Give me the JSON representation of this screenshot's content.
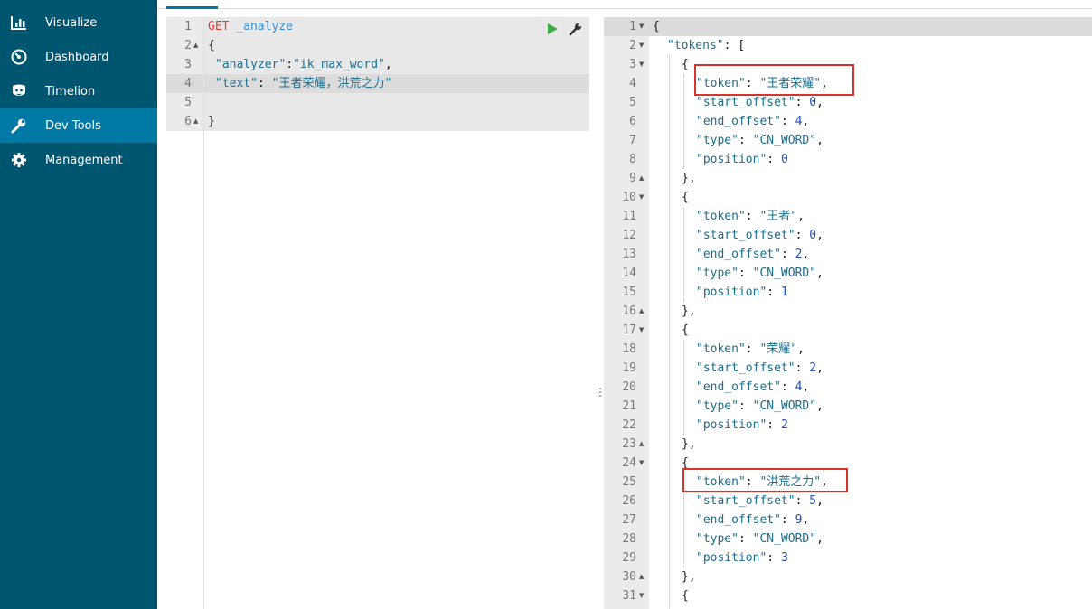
{
  "sidebar": {
    "items": [
      {
        "label": "Visualize",
        "icon": "bar-chart-icon"
      },
      {
        "label": "Dashboard",
        "icon": "dashboard-icon"
      },
      {
        "label": "Timelion",
        "icon": "timelion-icon"
      },
      {
        "label": "Dev Tools",
        "icon": "wrench-icon",
        "active": true
      },
      {
        "label": "Management",
        "icon": "gear-icon"
      }
    ]
  },
  "request": {
    "line_numbers": [
      "1",
      "2",
      "3",
      "4",
      "5",
      "6"
    ],
    "method": "GET",
    "path": "_analyze",
    "open_brace": "{",
    "analyzer_key": "\"analyzer\"",
    "analyzer_value": "\"ik_max_word\"",
    "text_key": "\"text\"",
    "text_value": "\"王者荣耀，洪荒之力\"",
    "close_brace": "}"
  },
  "response": {
    "line_numbers": [
      "1",
      "2",
      "3",
      "4",
      "5",
      "6",
      "7",
      "8",
      "9",
      "10",
      "11",
      "12",
      "13",
      "14",
      "15",
      "16",
      "17",
      "18",
      "19",
      "20",
      "21",
      "22",
      "23",
      "24",
      "25",
      "26",
      "27",
      "28",
      "29",
      "30",
      "31"
    ],
    "tokens_key": "\"tokens\"",
    "tokens": [
      {
        "token": "\"王者荣耀\"",
        "start_offset": "0",
        "end_offset": "4",
        "type": "\"CN_WORD\"",
        "position": "0"
      },
      {
        "token": "\"王者\"",
        "start_offset": "0",
        "end_offset": "2",
        "type": "\"CN_WORD\"",
        "position": "1"
      },
      {
        "token": "\"荣耀\"",
        "start_offset": "2",
        "end_offset": "4",
        "type": "\"CN_WORD\"",
        "position": "2"
      },
      {
        "token": "\"洪荒之力\"",
        "start_offset": "5",
        "end_offset": "9",
        "type": "\"CN_WORD\"",
        "position": "3"
      }
    ]
  },
  "colors": {
    "sidebar_bg": "#005571",
    "sidebar_active": "#0079a5",
    "annotation_box": "#d9332b"
  }
}
